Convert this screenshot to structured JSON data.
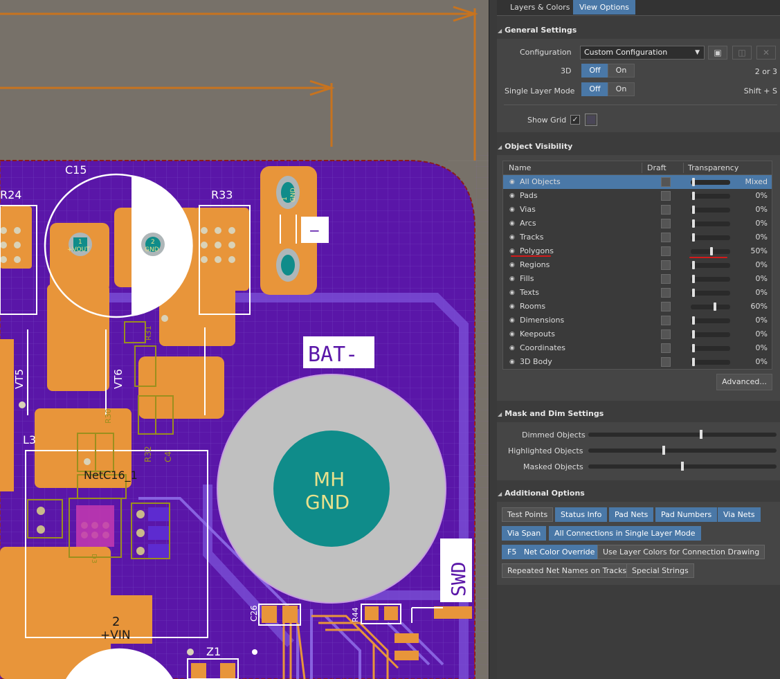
{
  "tabs": [
    {
      "label": "Layers & Colors",
      "active": false
    },
    {
      "label": "View Options",
      "active": true
    }
  ],
  "general": {
    "title": "General Settings",
    "configuration_label": "Configuration",
    "configuration_value": "Custom Configuration",
    "threed_label": "3D",
    "threed_off": "Off",
    "threed_on": "On",
    "threed_hint": "2 or 3",
    "single_layer_label": "Single Layer Mode",
    "single_off": "Off",
    "single_on": "On",
    "single_hint": "Shift + S",
    "show_grid_label": "Show Grid",
    "show_grid_checked": true
  },
  "object_visibility": {
    "title": "Object Visibility",
    "columns": [
      "Name",
      "Draft",
      "Transparency"
    ],
    "rows": [
      {
        "name": "All Objects",
        "value": "Mixed",
        "level": 0.0
      },
      {
        "name": "Pads",
        "value": "0%",
        "level": 0.0
      },
      {
        "name": "Vias",
        "value": "0%",
        "level": 0.0
      },
      {
        "name": "Arcs",
        "value": "0%",
        "level": 0.0
      },
      {
        "name": "Tracks",
        "value": "0%",
        "level": 0.0
      },
      {
        "name": "Polygons",
        "value": "50%",
        "level": 0.5
      },
      {
        "name": "Regions",
        "value": "0%",
        "level": 0.0
      },
      {
        "name": "Fills",
        "value": "0%",
        "level": 0.0
      },
      {
        "name": "Texts",
        "value": "0%",
        "level": 0.0
      },
      {
        "name": "Rooms",
        "value": "60%",
        "level": 0.6
      },
      {
        "name": "Dimensions",
        "value": "0%",
        "level": 0.0
      },
      {
        "name": "Keepouts",
        "value": "0%",
        "level": 0.0
      },
      {
        "name": "Coordinates",
        "value": "0%",
        "level": 0.0
      },
      {
        "name": "3D Body",
        "value": "0%",
        "level": 0.0
      }
    ],
    "advanced_button": "Advanced..."
  },
  "mask_dim": {
    "title": "Mask and Dim Settings",
    "sliders": [
      {
        "label": "Dimmed Objects",
        "level": 0.6
      },
      {
        "label": "Highlighted Objects",
        "level": 0.4
      },
      {
        "label": "Masked Objects",
        "level": 0.5
      }
    ]
  },
  "additional": {
    "title": "Additional Options",
    "buttons": [
      {
        "label": "Test Points",
        "on": false
      },
      {
        "label": "Status Info",
        "on": true
      },
      {
        "label": "Pad Nets",
        "on": true
      },
      {
        "label": "Pad Numbers",
        "on": true
      },
      {
        "label": "Via Nets",
        "on": true
      },
      {
        "label": "Via Span",
        "on": true
      },
      {
        "label": "All Connections in Single Layer Mode",
        "on": true
      },
      {
        "label": "F5   Net Color Override",
        "on": true
      },
      {
        "label": "Use Layer Colors for Connection Drawing",
        "on": false
      },
      {
        "label": "Repeated Net Names on Tracks",
        "on": false
      },
      {
        "label": "Special Strings",
        "on": false
      }
    ]
  },
  "pcb": {
    "designators": [
      "C15",
      "R24",
      "R33",
      "L3",
      "VT5",
      "VT6",
      "R32",
      "R31",
      "R30",
      "C4",
      "C26",
      "R44",
      "Z1",
      "D3"
    ],
    "pad_labels": {
      "c15_pad1_num": "1",
      "c15_pad1_net": "+VOUT",
      "c15_pad2_num": "2",
      "c15_pad2_net": "GND",
      "conn_pad_num": "1",
      "conn_pad_net": "GND",
      "vin_num": "2",
      "vin_net": "+VIN",
      "netc_label": "NetC16_1",
      "mh_top": "MH",
      "mh_bottom": "GND"
    },
    "silk_text": {
      "bat": "BAT-",
      "swd": "SWD",
      "minus": "−"
    }
  }
}
